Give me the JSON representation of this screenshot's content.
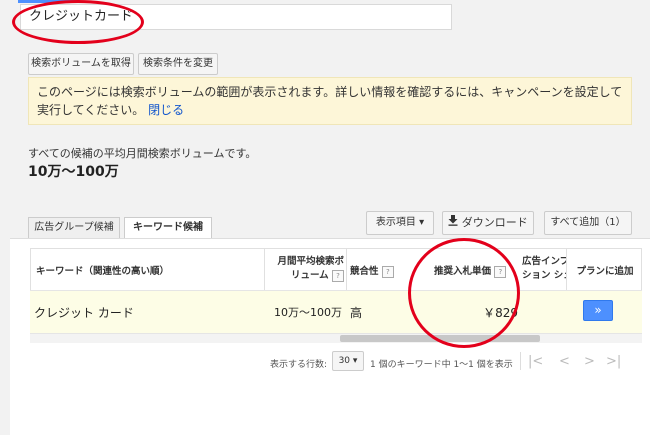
{
  "search": {
    "keyword_value": "クレジットカード"
  },
  "buttons": {
    "get_volume": "検索ボリュームを取得",
    "change_conditions": "検索条件を変更",
    "columns": "表示項目",
    "columns_caret": "▾",
    "download_icon": "download-icon",
    "download": "ダウンロード",
    "add_all": "すべて追加（1）"
  },
  "notice": {
    "text": "このページには検索ボリュームの範囲が表示されます。詳しい情報を確認するには、キャンペーンを設定して実行してください。",
    "close": "閉じる"
  },
  "stats": {
    "label": "すべての候補の平均月間検索ボリュームです。",
    "value": "10万〜100万"
  },
  "tabs": [
    {
      "label": "広告グループ候補",
      "active": false
    },
    {
      "label": "キーワード候補",
      "active": true
    }
  ],
  "table": {
    "headers": {
      "keyword": "キーワード（関連性の高い順）",
      "volume_line1": "月間平均検索ボ",
      "volume_line2": "リューム",
      "competition": "競合性",
      "bid": "推奨入札単価",
      "impression_line1": "広告インプ",
      "impression_line2": "ション シェ",
      "add": "プランに追加",
      "help": "?"
    },
    "rows": [
      {
        "keyword": "クレジット カード",
        "volume": "10万〜100万",
        "competition": "高",
        "bid": "￥829",
        "add_icon": "»"
      }
    ]
  },
  "pager": {
    "rows_label": "表示する行数:",
    "rows_value": "30",
    "rows_caret": "▾",
    "range_text": "1 個のキーワード中 1〜1 個を表示",
    "first": "|<",
    "prev": "<",
    "next": ">",
    "last": ">|"
  },
  "colors": {
    "accent": "#4d90fe",
    "highlight_circle": "#e3001b",
    "notice_bg": "#fdf6d8"
  }
}
